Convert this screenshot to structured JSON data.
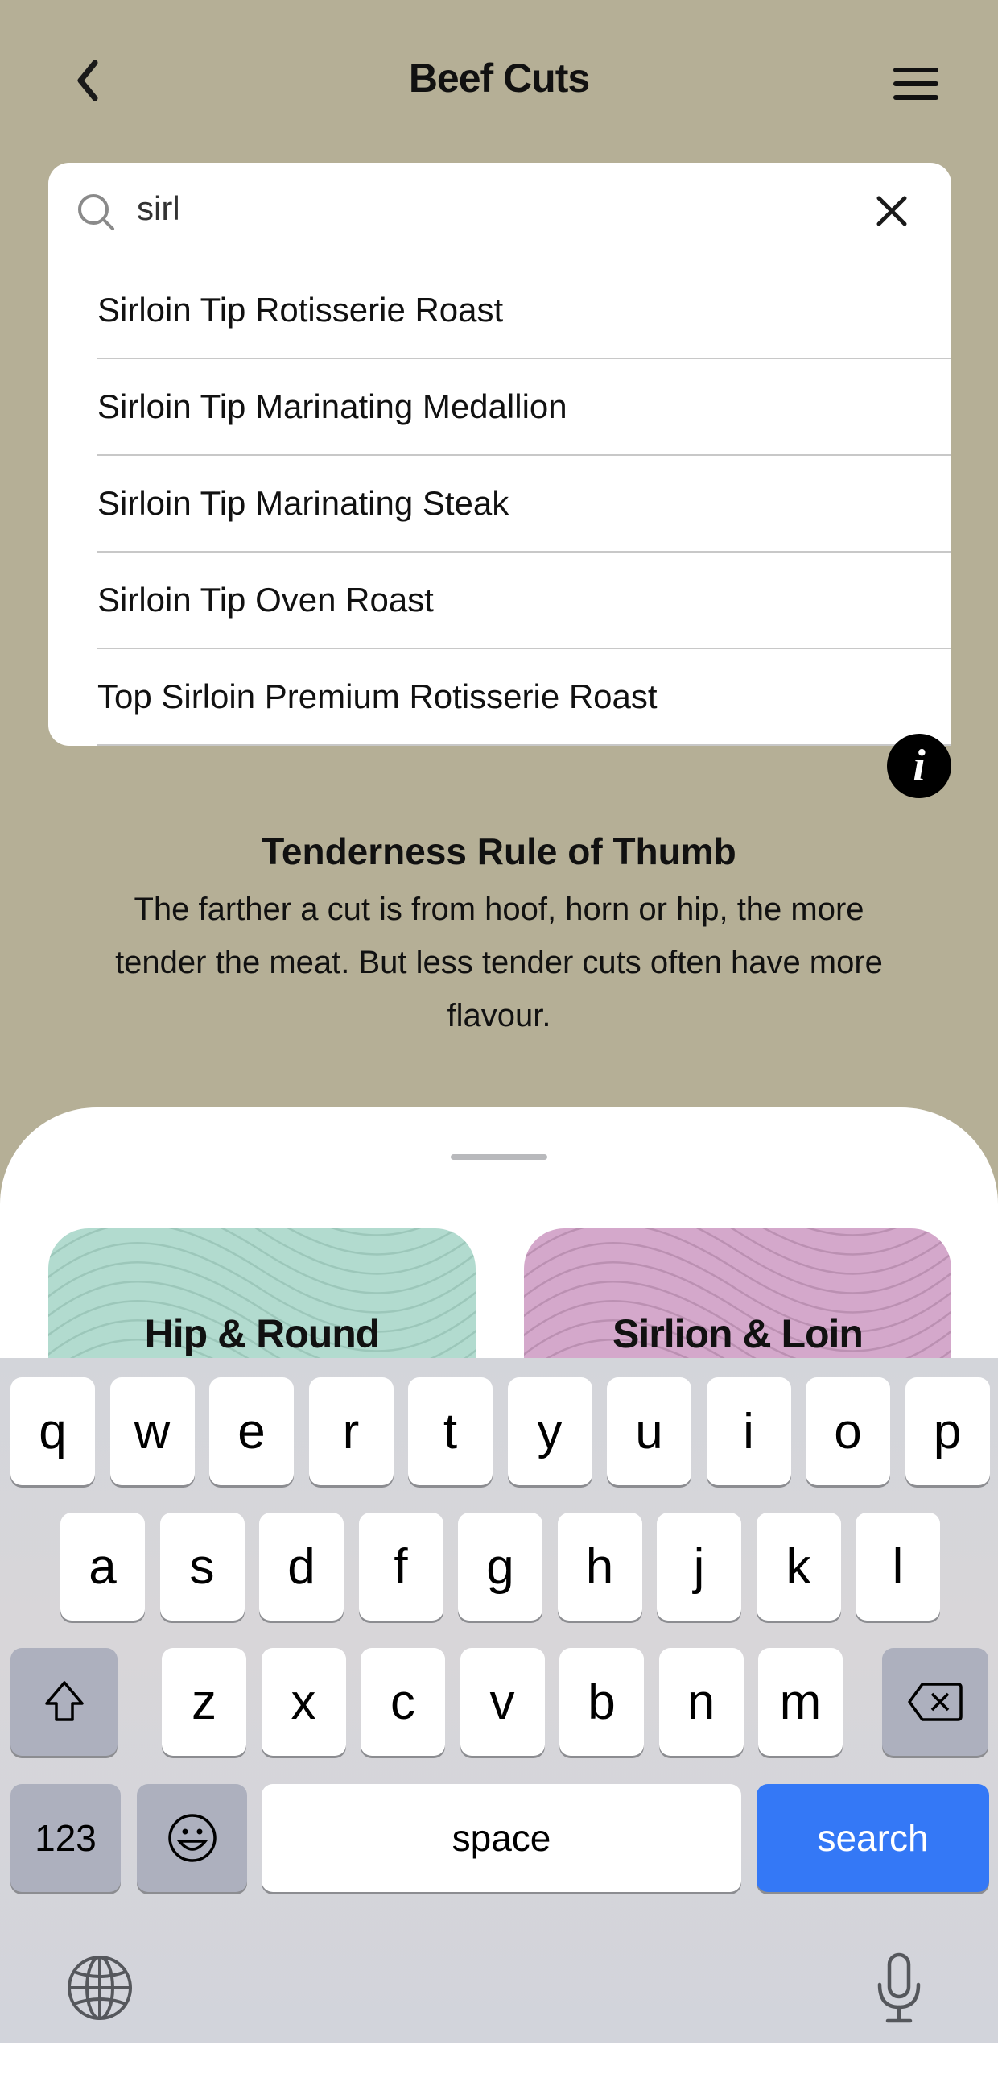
{
  "header": {
    "title": "Beef Cuts",
    "back_icon": "chevron-left-icon",
    "menu_icon": "hamburger-menu-icon"
  },
  "search": {
    "value": "sirl",
    "search_icon": "magnifier-icon",
    "clear_icon": "close-x-icon",
    "suggestions": [
      "Sirloin Tip Rotisserie Roast",
      "Sirloin Tip Marinating Medallion",
      "Sirloin Tip Marinating Steak",
      "Sirloin Tip Oven Roast",
      "Top Sirloin Premium Rotisserie Roast"
    ]
  },
  "info": {
    "icon": "info-icon",
    "glyph": "i"
  },
  "tip": {
    "title": "Tenderness Rule of Thumb",
    "body": "The farther a cut is from hoof, horn or hip, the more tender the meat. But less tender cuts often have more flavour."
  },
  "categories": [
    {
      "label": "Hip & Round",
      "color": "#b2dbcf",
      "wave": "#9cc7ba"
    },
    {
      "label": "Sirlion & Loin",
      "color": "#d4a8cb",
      "wave": "#bb90b2"
    }
  ],
  "keyboard": {
    "row1": [
      "q",
      "w",
      "e",
      "r",
      "t",
      "y",
      "u",
      "i",
      "o",
      "p"
    ],
    "row2": [
      "a",
      "s",
      "d",
      "f",
      "g",
      "h",
      "j",
      "k",
      "l"
    ],
    "row3": [
      "z",
      "x",
      "c",
      "v",
      "b",
      "n",
      "m"
    ],
    "numbers": "123",
    "space": "space",
    "search": "search",
    "search_color": "#3478f6",
    "shift_icon": "shift-icon",
    "delete_icon": "backspace-icon",
    "emoji_icon": "emoji-icon",
    "globe_icon": "globe-icon",
    "mic_icon": "microphone-icon"
  }
}
